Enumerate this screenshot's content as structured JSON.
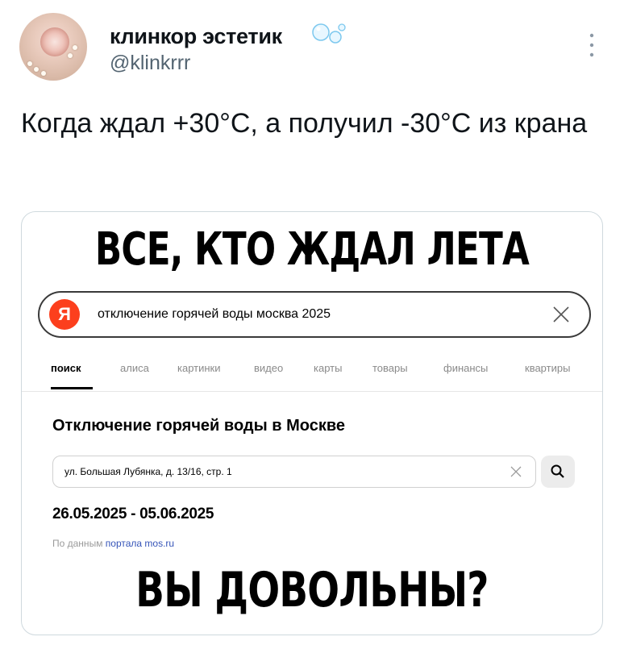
{
  "tweet": {
    "display_name": "клинкор эстетик",
    "handle": "@klinkrrr",
    "text": "Когда ждал +30°С, а получил -30°С из крана"
  },
  "meme": {
    "top_caption": "ВСЕ, КТО ЖДАЛ ЛЕТА",
    "bottom_caption": "ВЫ ДОВОЛЬНЫ?",
    "search": {
      "logo": "Я",
      "query": "отключение горячей воды москва 2025"
    },
    "tabs": [
      "поиск",
      "алиса",
      "картинки",
      "видео",
      "карты",
      "товары",
      "финансы",
      "квартиры"
    ],
    "result": {
      "title": "Отключение горячей воды в Москве",
      "address": "ул. Большая Лубянка, д. 13/16, стр. 1",
      "dates": "26.05.2025 - 05.06.2025",
      "source_prefix": "По данным",
      "source_link": "портала mos.ru"
    }
  },
  "colors": {
    "yandex_red": "#fc3f1d",
    "link_blue": "#3554b8",
    "handle_gray": "#536471"
  },
  "icons": [
    "bubbles-emoji-icon",
    "more-vertical-icon",
    "close-icon",
    "search-icon"
  ]
}
